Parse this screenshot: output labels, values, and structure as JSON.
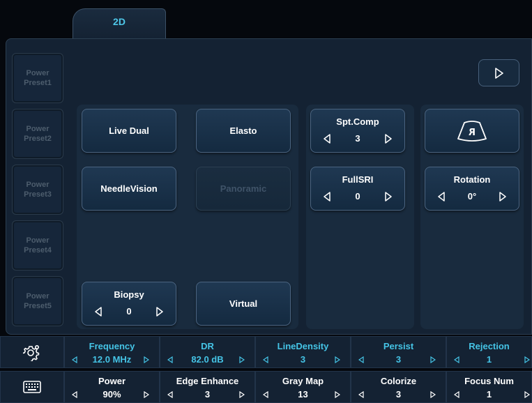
{
  "tabs": [
    {
      "label": "2D"
    }
  ],
  "presets": [
    {
      "line1": "Power",
      "line2": "Preset1"
    },
    {
      "line1": "Power",
      "line2": "Preset2"
    },
    {
      "line1": "Power",
      "line2": "Preset3"
    },
    {
      "line1": "Power",
      "line2": "Preset4"
    },
    {
      "line1": "Power",
      "line2": "Preset5"
    }
  ],
  "nav": {
    "icon": "play-triangle-icon"
  },
  "modes": {
    "live_dual": "Live Dual",
    "elasto": "Elasto",
    "needle_vision": "NeedleVision",
    "panoramic": "Panoramic",
    "virtual": "Virtual",
    "biopsy": {
      "label": "Biopsy",
      "value": "0"
    }
  },
  "params": {
    "spt_comp": {
      "label": "Spt.Comp",
      "value": "3"
    },
    "full_sri": {
      "label": "FullSRI",
      "value": "0"
    },
    "flip": {
      "icon": "flip-probe-icon",
      "glyph": "R"
    },
    "rotation": {
      "label": "Rotation",
      "value": "0°"
    }
  },
  "bottom_row1": [
    {
      "label": "Frequency",
      "value": "12.0 MHz",
      "accent": true
    },
    {
      "label": "DR",
      "value": "82.0 dB",
      "accent": true
    },
    {
      "label": "LineDensity",
      "value": "3",
      "accent": true
    },
    {
      "label": "Persist",
      "value": "3",
      "accent": true
    },
    {
      "label": "Rejection",
      "value": "1",
      "accent": true
    }
  ],
  "bottom_row2": [
    {
      "label": "Power",
      "value": "90%"
    },
    {
      "label": "Edge Enhance",
      "value": "3"
    },
    {
      "label": "Gray Map",
      "value": "13"
    },
    {
      "label": "Colorize",
      "value": "3"
    },
    {
      "label": "Focus Num",
      "value": "1"
    }
  ],
  "bottom_icons": [
    "gear-settings-icon",
    "keyboard-icon"
  ],
  "colors": {
    "accent": "#45c4e6",
    "panel": "#142233",
    "button_border": "#4b6480"
  }
}
